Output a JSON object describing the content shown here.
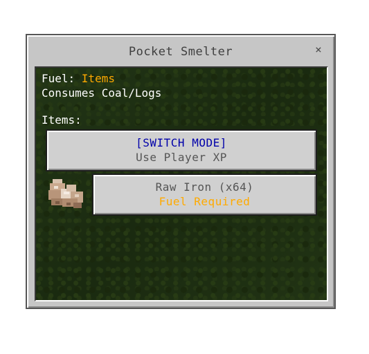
{
  "window": {
    "title": "Pocket Smelter",
    "close_glyph": "×"
  },
  "fuel": {
    "label": "Fuel: ",
    "value": "Items",
    "value_color": "#ffaa00",
    "consumes": "Consumes Coal/Logs"
  },
  "items": {
    "heading": "Items:",
    "switch_button": {
      "title": "[SWITCH MODE]",
      "title_color": "#0000aa",
      "subtitle": "Use Player XP"
    },
    "entries": [
      {
        "icon": "raw-iron-icon",
        "name": "Raw Iron (x64)",
        "status": "Fuel Required",
        "status_color": "#ffaa00"
      }
    ]
  }
}
